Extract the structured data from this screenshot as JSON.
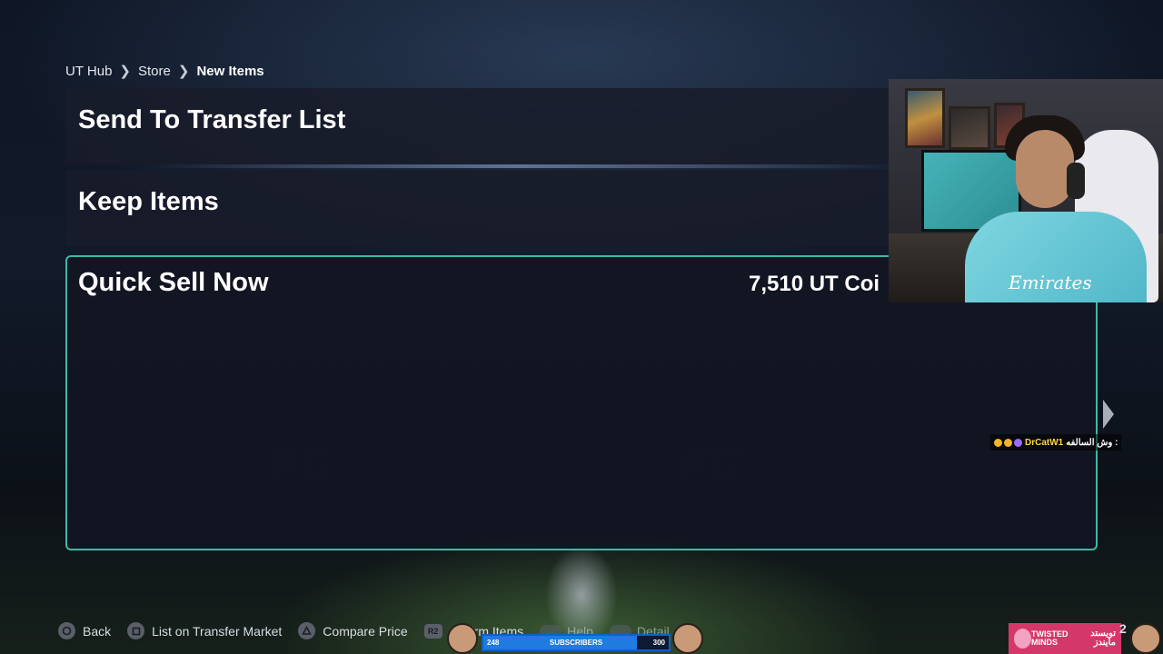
{
  "breadcrumb": {
    "items": [
      "UT Hub",
      "Store",
      "New Items"
    ]
  },
  "options": {
    "send_to_transfer": "Send To Transfer List",
    "keep_items": "Keep Items",
    "quick_sell": "Quick Sell Now",
    "quick_sell_value": "7,510 UT Coi"
  },
  "controls": {
    "back": "Back",
    "list_on_transfer": "List on Transfer Market",
    "compare_price": "Compare Price",
    "r2_icon": "R2",
    "confirm": "firm Items",
    "help": "Help",
    "details": "Detail"
  },
  "stream": {
    "chat_user": "DrCatW1",
    "chat_message": "وش السالفه :",
    "subscribers_label": "SUBSCRIBERS",
    "subscribers_current": "248",
    "subscribers_goal": "300",
    "subscribers_progress": 0.83,
    "sponsor_en": "TWISTED MINDS",
    "sponsor_ar": "تويستد مايندز",
    "side_number": "2",
    "shirt_text": "Emirates"
  },
  "colors": {
    "selection_border": "#3fb9a6",
    "panel_bg": "#181c2a",
    "subscriber_bar": "#1f7be0",
    "sponsor_bg": "#d4386a"
  }
}
